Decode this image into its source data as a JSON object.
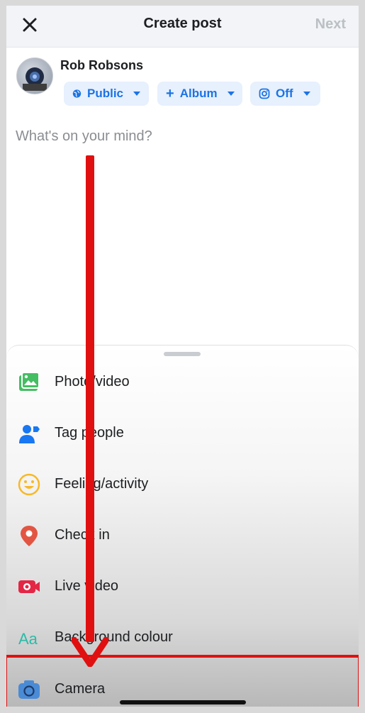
{
  "header": {
    "title": "Create post",
    "next_label": "Next"
  },
  "user": {
    "name": "Rob Robsons"
  },
  "pills": [
    {
      "label": "Public"
    },
    {
      "label": "Album"
    },
    {
      "label": "Off"
    }
  ],
  "composer": {
    "placeholder": "What's on your mind?"
  },
  "options": [
    {
      "label": "Photo/video",
      "icon": "photo-icon",
      "color": "#45bd62"
    },
    {
      "label": "Tag people",
      "icon": "tag-people-icon",
      "color": "#1877f2"
    },
    {
      "label": "Feeling/activity",
      "icon": "smiley-icon",
      "color": "#f7b928"
    },
    {
      "label": "Check in",
      "icon": "location-pin-icon",
      "color": "#e25542"
    },
    {
      "label": "Live video",
      "icon": "live-video-icon",
      "color": "#e42645"
    },
    {
      "label": "Background colour",
      "icon": "text-aa-icon",
      "color": "#2abba7"
    },
    {
      "label": "Camera",
      "icon": "camera-icon",
      "color": "#4a8bd6"
    }
  ],
  "annotation": {
    "color": "#e01010"
  }
}
